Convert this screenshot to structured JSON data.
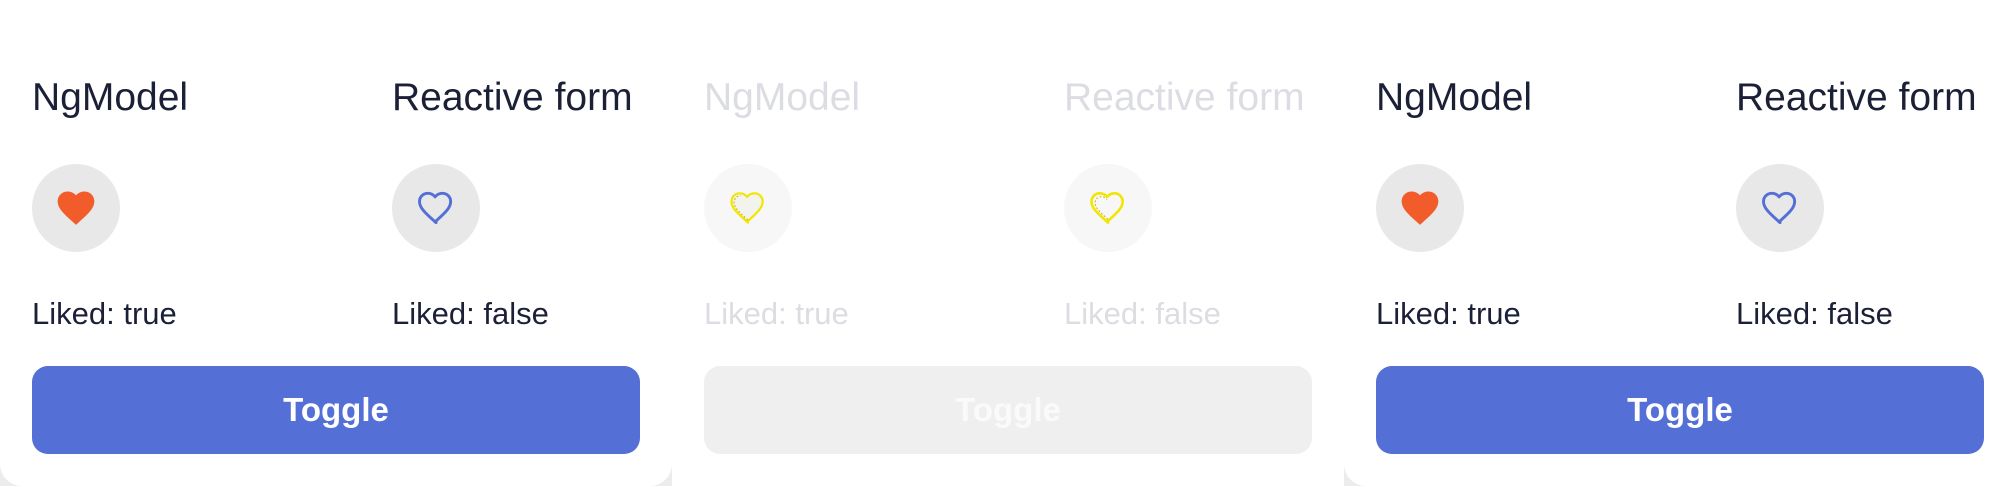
{
  "colors": {
    "accent": "#5470d6",
    "heart_filled": "#f25c2b",
    "heart_outline": "#5470d6",
    "heart_disabled": "#f2e500",
    "text": "#1b2037",
    "text_disabled": "#dcdde2",
    "button_disabled": "#efefef"
  },
  "panels": [
    {
      "state": "enabled",
      "ngmodel": {
        "label": "NgModel",
        "status": "Liked: true",
        "icon": "heart-filled-icon"
      },
      "reactive": {
        "label": "Reactive form",
        "status": "Liked: false",
        "icon": "heart-outline-icon"
      },
      "toggle_label": "Toggle"
    },
    {
      "state": "disabled",
      "ngmodel": {
        "label": "NgModel",
        "status": "Liked: true",
        "icon": "heart-disabled-icon"
      },
      "reactive": {
        "label": "Reactive form",
        "status": "Liked: false",
        "icon": "heart-disabled-icon"
      },
      "toggle_label": "Toggle"
    },
    {
      "state": "enabled",
      "ngmodel": {
        "label": "NgModel",
        "status": "Liked: true",
        "icon": "heart-filled-icon"
      },
      "reactive": {
        "label": "Reactive form",
        "status": "Liked: false",
        "icon": "heart-outline-icon"
      },
      "toggle_label": "Toggle"
    }
  ]
}
